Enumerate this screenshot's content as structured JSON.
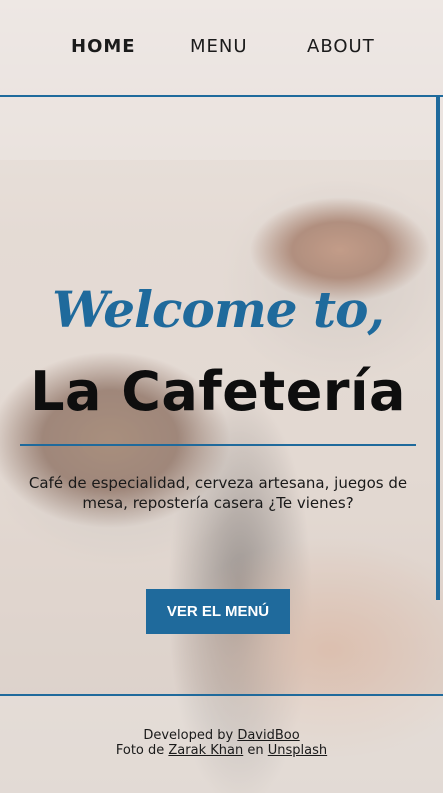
{
  "nav": {
    "home": "HOME",
    "menu": "MENU",
    "about": "ABOUT"
  },
  "hero": {
    "welcome": "Welcome to,",
    "title": "La Cafetería",
    "tagline": "Café de especialidad, cerveza artesana, juegos de mesa, repostería casera ¿Te vienes?",
    "cta_label": "VER EL MENÚ"
  },
  "footer": {
    "developed_prefix": "Developed by",
    "developer_link": "DavidBoo",
    "photo_prefix": "Foto de",
    "photographer_link": "Zarak Khan",
    "photo_middle": "en",
    "source_link": "Unsplash"
  },
  "colors": {
    "accent": "#1f6a9c",
    "text": "#1b1b1b",
    "button_text": "#ffffff"
  }
}
